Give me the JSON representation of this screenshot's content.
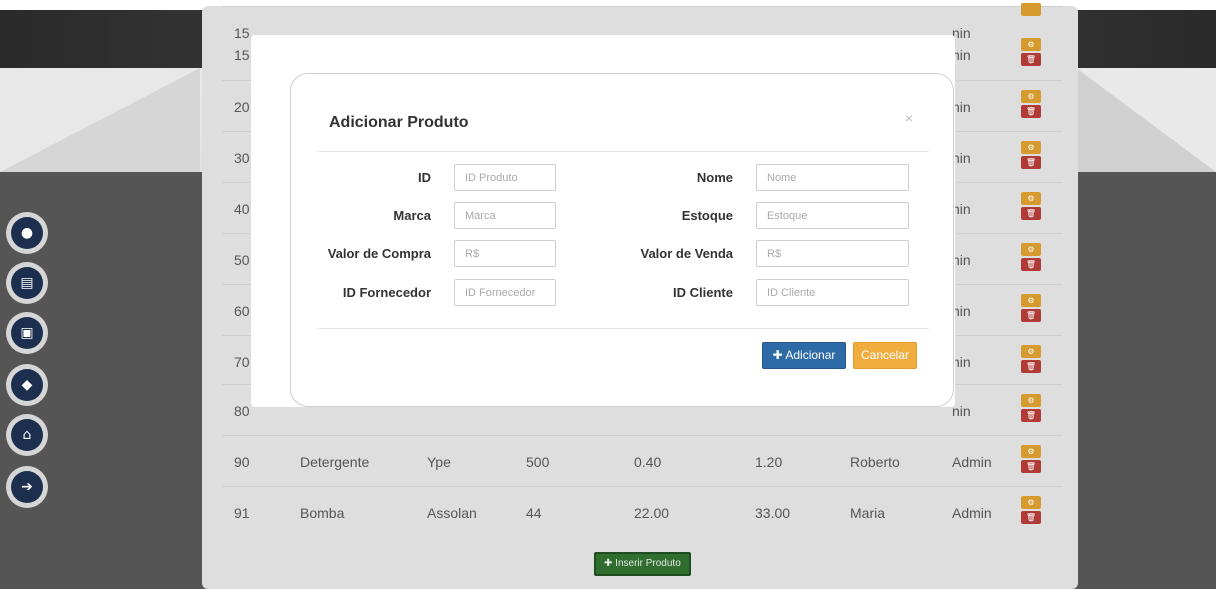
{
  "table": {
    "rows": [
      {
        "id": "15",
        "name": "",
        "brand": "",
        "stock": "",
        "buy": "",
        "sell": "",
        "client": "",
        "user": "nin"
      },
      {
        "id": "20",
        "name": "",
        "brand": "",
        "stock": "",
        "buy": "",
        "sell": "",
        "client": "",
        "user": "nin"
      },
      {
        "id": "30",
        "name": "",
        "brand": "",
        "stock": "",
        "buy": "",
        "sell": "",
        "client": "",
        "user": "nin"
      },
      {
        "id": "40",
        "name": "",
        "brand": "",
        "stock": "",
        "buy": "",
        "sell": "",
        "client": "",
        "user": "nin"
      },
      {
        "id": "50",
        "name": "",
        "brand": "",
        "stock": "",
        "buy": "",
        "sell": "",
        "client": "",
        "user": "nin"
      },
      {
        "id": "60",
        "name": "",
        "brand": "",
        "stock": "",
        "buy": "",
        "sell": "",
        "client": "",
        "user": "nin"
      },
      {
        "id": "70",
        "name": "",
        "brand": "",
        "stock": "",
        "buy": "",
        "sell": "",
        "client": "",
        "user": "nin"
      },
      {
        "id": "80",
        "name": "",
        "brand": "",
        "stock": "",
        "buy": "",
        "sell": "",
        "client": "",
        "user": "nin"
      },
      {
        "id": "90",
        "name": "Detergente",
        "brand": "Ype",
        "stock": "500",
        "buy": "0.40",
        "sell": "1.20",
        "client": "Roberto",
        "user": "Admin"
      },
      {
        "id": "91",
        "name": "Bomba",
        "brand": "Assolan",
        "stock": "44",
        "buy": "22.00",
        "sell": "33.00",
        "client": "Maria",
        "user": "Admin"
      }
    ],
    "insert_label": "Inserir Produto"
  },
  "sidenav": {
    "items": [
      "user-icon",
      "document-icon",
      "archive-icon",
      "truck-icon",
      "unlock-icon",
      "logout-icon"
    ]
  },
  "modal": {
    "title": "Adicionar Produto",
    "close": "×",
    "fields": {
      "id": {
        "label": "ID",
        "placeholder": "ID Produto"
      },
      "nome": {
        "label": "Nome",
        "placeholder": "Nome"
      },
      "marca": {
        "label": "Marca",
        "placeholder": "Marca"
      },
      "estoque": {
        "label": "Estoque",
        "placeholder": "Estoque"
      },
      "valor_compra": {
        "label": "Valor de Compra",
        "placeholder": "R$"
      },
      "valor_venda": {
        "label": "Valor de Venda",
        "placeholder": "R$"
      },
      "id_fornecedor": {
        "label": "ID Fornecedor",
        "placeholder": "ID Fornecedor"
      },
      "id_cliente": {
        "label": "ID Cliente",
        "placeholder": "ID Cliente"
      }
    },
    "add_label": "Adicionar",
    "cancel_label": "Cancelar"
  },
  "colors": {
    "primary": "#2d6aa6",
    "warning": "#f0ad3e",
    "danger": "#b03a35",
    "success": "#2f6e2f",
    "nav": "#1c2f4e"
  }
}
